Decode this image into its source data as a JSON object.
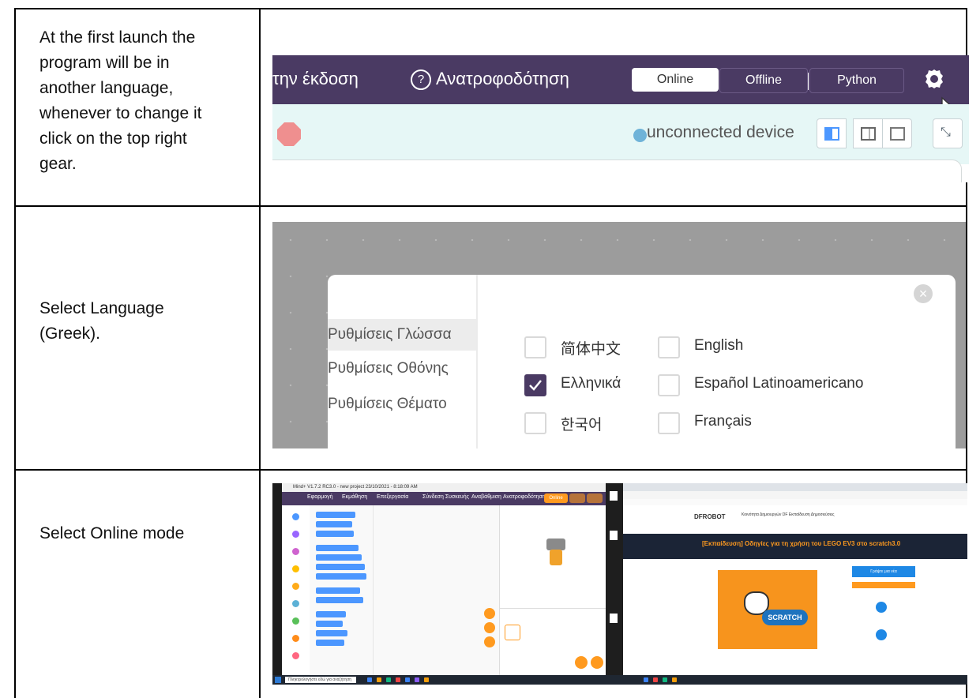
{
  "rows": [
    {
      "instruction": "At the first launch the\nprogram will be in\nanother language,\nwhenever to change it\nclick on the top right\ngear."
    },
    {
      "instruction": "Select Language\n(Greek)."
    },
    {
      "instruction": "Select Online mode"
    }
  ],
  "shot1": {
    "partial_version": "την έκδοση",
    "feedback_icon": "?",
    "feedback": "Ανατροφοδότηση",
    "modes": [
      "Online",
      "Offline",
      "Python"
    ],
    "connection": "unconnected device",
    "colors": {
      "bar": "#4a3a63",
      "subbar": "#e6f7f6",
      "stop": "#ef8f8f"
    }
  },
  "shot2": {
    "close_glyph": "×",
    "settings_menu": [
      "Ρυθμίσεις Γλώσσα",
      "Ρυθμίσεις Οθόνης",
      "Ρυθμίσεις Θέματο"
    ],
    "languages": [
      {
        "label": "简体中文",
        "checked": false
      },
      {
        "label": "English",
        "checked": false
      },
      {
        "label": "Ελληνικά",
        "checked": true
      },
      {
        "label": "Español Latinoamericano",
        "checked": false
      },
      {
        "label": "한국어",
        "checked": false
      },
      {
        "label": "Français",
        "checked": false
      }
    ]
  },
  "shot3": {
    "title": "Mind+ V1.7.2 RC3.0 - new project 23/10/2021 - 8:18:09 AM",
    "menu": [
      "Εφαρμογή",
      "Εκμάθηση",
      "Επεξεργασία",
      "Σύνδεση Συσκευής",
      "Αναβάθμιση",
      "Ανατροφοδότηση"
    ],
    "online": "Online",
    "site_logo": "DFROBOT",
    "site_nav": "Κοινότητα Δημιουργών DF  Εκπαίδευση  Δημοσιεύσεις",
    "banner": "[Εκπαίδευση] Οδηγίες για τη χρήση του LEGO EV3 στο scratch3.0",
    "scratch_word": "SCRATCH",
    "side_button": "Γράψτε μια νέα",
    "search": "Πληκτρολογήστε εδώ για αναζήτηση"
  }
}
